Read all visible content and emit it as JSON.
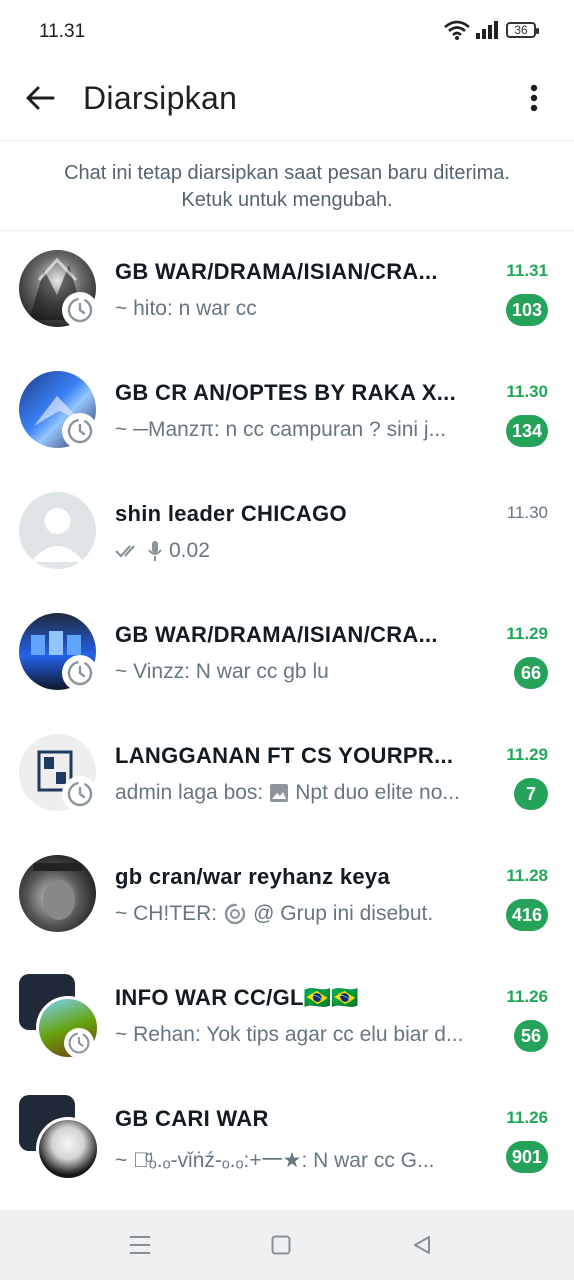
{
  "status_bar": {
    "time": "11.31",
    "battery": "36"
  },
  "app_bar": {
    "title": "Diarsipkan"
  },
  "banner": {
    "line1": "Chat ini tetap diarsipkan saat pesan baru diterima.",
    "line2": "Ketuk untuk mengubah."
  },
  "chats": [
    {
      "name": "GB WAR/DRAMA/ISIAN/CRA...",
      "time": "11.31",
      "preview": "~ hito: n war cc",
      "unread": "103"
    },
    {
      "name": "GB CR AN/OPTES BY RAKA X...",
      "time": "11.30",
      "preview": "~ ─Manzπ: n cc campuran ? sini j...",
      "unread": "134"
    },
    {
      "name": "shin leader CHICAGO",
      "time": "11.30",
      "preview": "0.02",
      "unread": ""
    },
    {
      "name": "GB WAR/DRAMA/ISIAN/CRA...",
      "time": "11.29",
      "preview": "~ Vinzz: N war cc gb lu",
      "unread": "66"
    },
    {
      "name": "LANGGANAN FT CS YOURPR...",
      "time": "11.29",
      "preview": "admin laga bos:",
      "preview2": "Npt duo elite no...",
      "unread": "7"
    },
    {
      "name": "gb cran/war  reyhanz keya",
      "time": "11.28",
      "preview": "~ CH!TER:",
      "preview2": "@ Grup ini disebut.",
      "unread": "416"
    },
    {
      "name": "INFO WAR CC/GL🇧🇷🇧🇷",
      "time": "11.26",
      "preview": "~ Rehan: Yok tips agar cc elu biar d...",
      "unread": "56"
    },
    {
      "name": "GB CARI WAR",
      "time": "11.26",
      "preview": "~ 一ͦ̈ₒ.ₒ-vǐṅź-ₒ.ₒ:+一★: N war cc G...",
      "unread": "901"
    }
  ],
  "colors": {
    "accent": "#25a35a",
    "muted": "#667781"
  }
}
